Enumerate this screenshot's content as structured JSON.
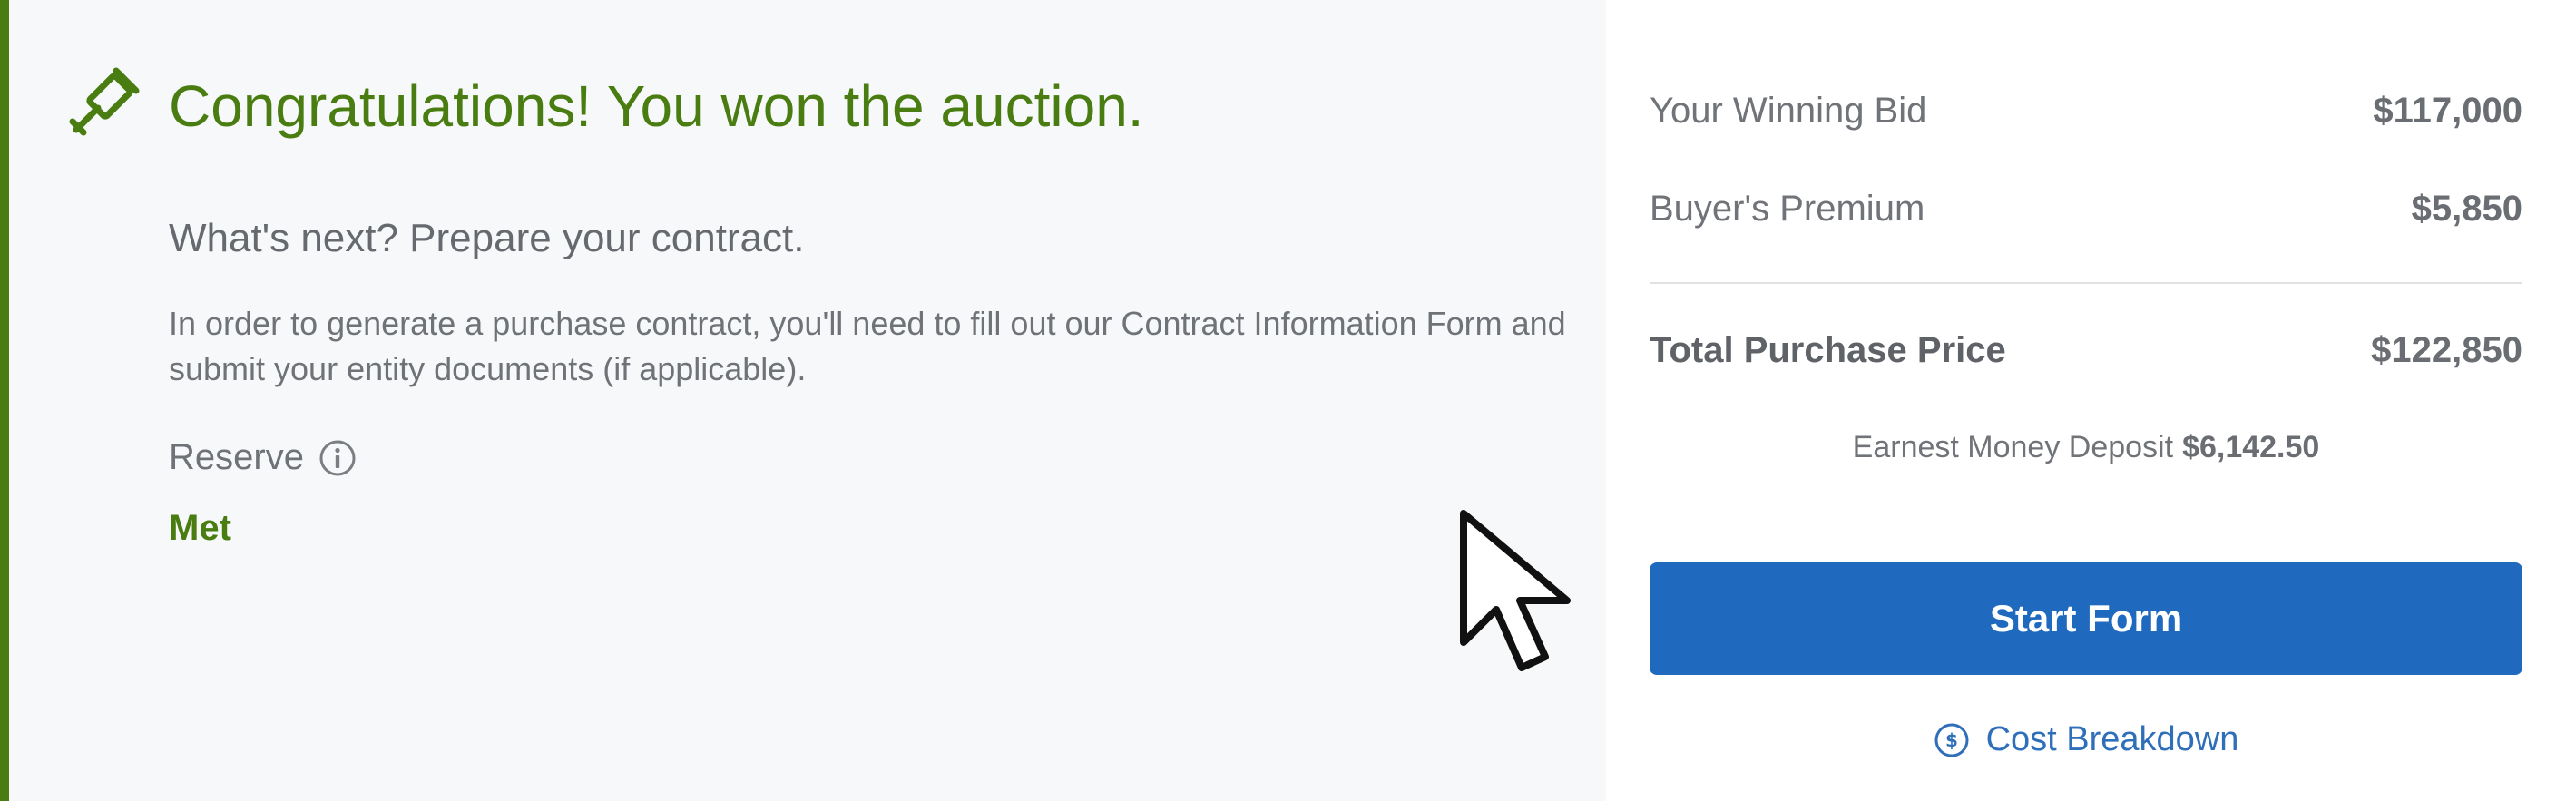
{
  "colors": {
    "accent_green": "#4a7d11",
    "primary_blue": "#1f69be",
    "link_blue": "#2f6fba"
  },
  "icons": {
    "gavel": "gavel-icon",
    "info": "info-icon",
    "dollar": "dollar-circle-icon",
    "cursor": "mouse-pointer-icon"
  },
  "status": {
    "headline": "Congratulations! You won the auction.",
    "next_step": "What's next? Prepare your contract.",
    "description": "In order to generate a purchase contract, you'll need to fill out our Contract Information Form and submit your entity documents (if applicable).",
    "reserve_label": "Reserve",
    "reserve_value": "Met"
  },
  "summary": {
    "winning_bid_label": "Your Winning Bid",
    "winning_bid_amount": "$117,000",
    "premium_label": "Buyer's Premium",
    "premium_amount": "$5,850",
    "total_label": "Total Purchase Price",
    "total_amount": "$122,850",
    "deposit_label": "Earnest Money Deposit",
    "deposit_amount": "$6,142.50"
  },
  "actions": {
    "start_form_label": "Start Form",
    "cost_breakdown_label": "Cost Breakdown"
  }
}
